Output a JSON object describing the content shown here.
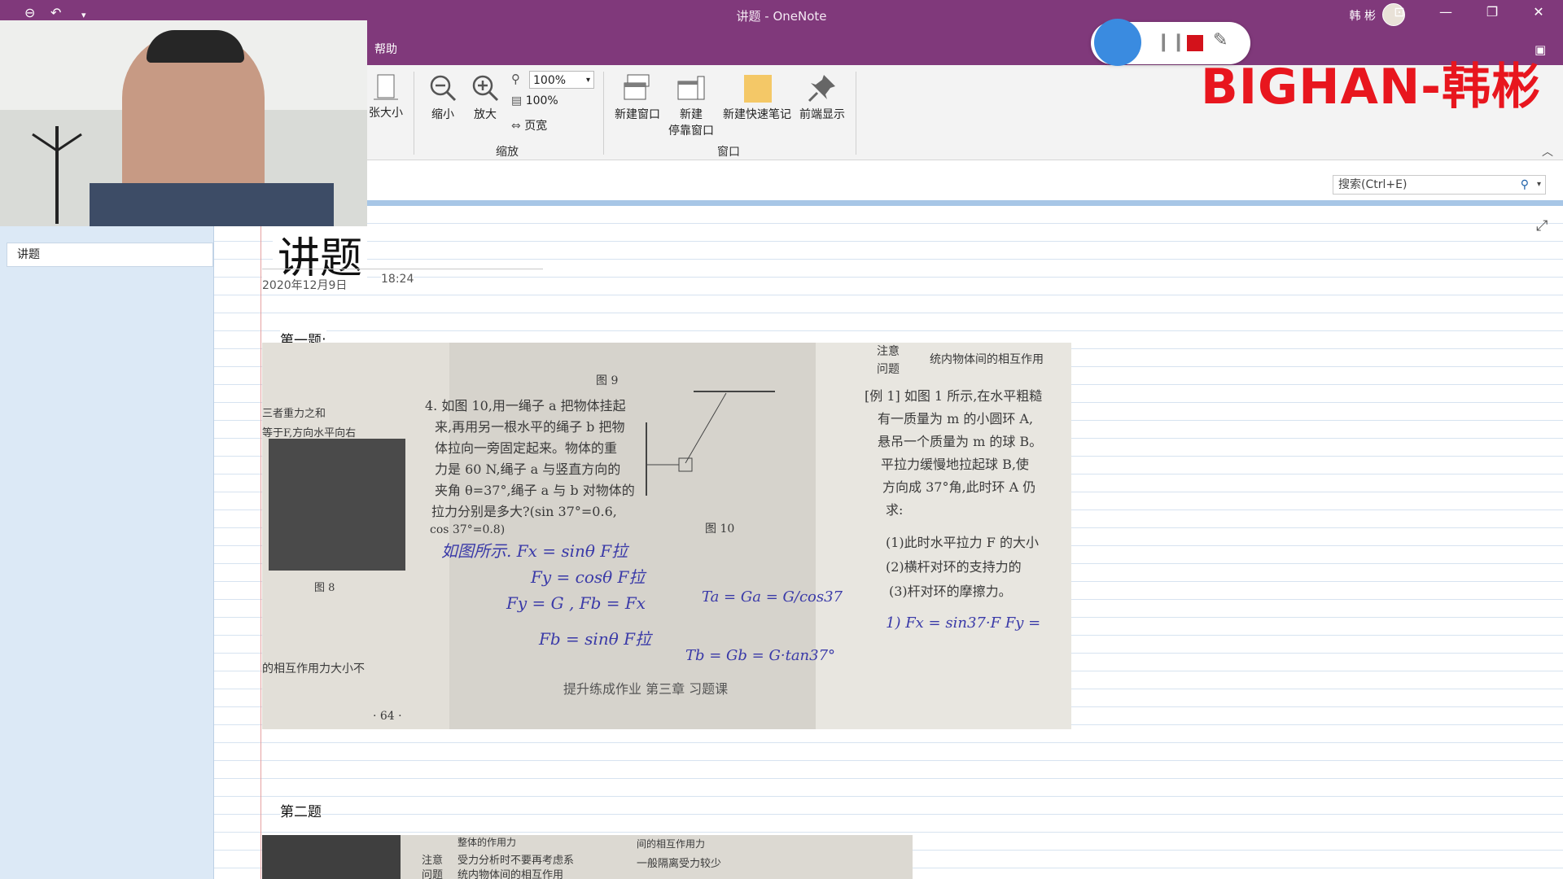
{
  "window": {
    "title": "讲题 - OneNote",
    "user_name": "韩 彬"
  },
  "menu": {
    "help": "帮助"
  },
  "ribbon": {
    "zoom_group_label": "缩放",
    "window_group_label": "窗口",
    "page_zoom_partial": "张大小",
    "zoom_out": "缩小",
    "zoom_in": "放大",
    "zoom_value": "100%",
    "hundred_percent": "100%",
    "page_width": "页宽",
    "new_window": "新建窗口",
    "new_docked_window_line1": "新建",
    "new_docked_window_line2": "停靠窗口",
    "new_quick_note": "新建快速笔记",
    "always_on_top": "前端显示"
  },
  "search": {
    "placeholder": "搜索(Ctrl+E)"
  },
  "sidebar": {
    "pages": [
      {
        "label": "讲题"
      }
    ]
  },
  "page": {
    "title": "讲题",
    "date": "2020年12月9日",
    "time": "18:24",
    "heading_1": "第一题:",
    "heading_2": "第二题"
  },
  "photo_text": {
    "fig9": "图 9",
    "q_line1": "4. 如图 10,用一绳子 a 把物体挂起",
    "q_line2": "来,再用另一根水平的绳子 b 把物",
    "q_line3": "体拉向一旁固定起来。物体的重",
    "q_line4": "力是 60 N,绳子 a 与竖直方向的",
    "q_line5": "夹角 θ=37°,绳子 a 与 b 对物体的",
    "q_line6": "拉力分别是多大?(sin 37°=0.6,",
    "q_line7": "cos 37°=0.8)",
    "fig10": "图 10",
    "fig8": "图 8",
    "left_line1": "三者重力之和",
    "left_line2": "等于F,方向水平向右",
    "left_line3": "的相互作用力大小不",
    "footer_text": "提升练成作业  第三章  习题课",
    "page_num": "· 64 ·",
    "right_box1": "注意",
    "right_box2": "问题",
    "right_box_text": "统内物体间的相互作用",
    "ex_line1": "[例 1] 如图 1 所示,在水平粗糙",
    "ex_line2": "有一质量为 m 的小圆环 A,",
    "ex_line3": "悬吊一个质量为 m 的球 B。",
    "ex_line4": "平拉力缓慢地拉起球 B,使",
    "ex_line5": "方向成 37°角,此时环 A 仍",
    "ex_line6": "求:",
    "ex_line7": "(1)此时水平拉力 F 的大小",
    "ex_line8": "(2)横杆对环的支持力的",
    "ex_line9": "(3)杆对环的摩擦力。",
    "hw1": "如图所示. Fx = sinθ F拉",
    "hw2": "Fy = cosθ F拉",
    "hw3": "Fy = G , Fb = Fx",
    "hw4": "Fb = sinθ F拉",
    "hw5": "Ta = Ga = G/cos37",
    "hw6": "Tb = Gb = G·tan37°",
    "hw7": "1) Fx = sin37·F  Fy =",
    "p2_line1": "受力分析时不要再考虑系",
    "p2_line2": "统内物体间的相互作用",
    "p2_line3": "一般隔离受力较少",
    "p2_head1": "注意",
    "p2_head2": "问题",
    "p2_top1": "整体的作用力",
    "p2_top2": "间的相互作用力"
  },
  "overlay": {
    "watermark": "BIGHAN-韩彬"
  },
  "colors": {
    "title_bar": "#80397b",
    "ribbon": "#f3f3f3",
    "sidebar": "#dce9f6",
    "watermark": "#e8161e"
  }
}
